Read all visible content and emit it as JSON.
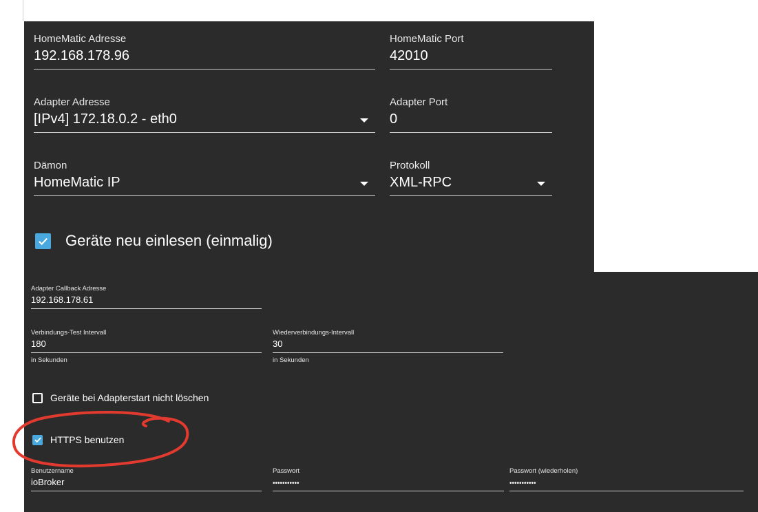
{
  "homematic_address": {
    "label": "HomeMatic Adresse",
    "value": "192.168.178.96"
  },
  "homematic_port": {
    "label": "HomeMatic Port",
    "value": "42010"
  },
  "adapter_address": {
    "label": "Adapter Adresse",
    "value": "[IPv4] 172.18.0.2 - eth0"
  },
  "adapter_port": {
    "label": "Adapter Port",
    "value": "0"
  },
  "daemon": {
    "label": "Dämon",
    "value": "HomeMatic IP"
  },
  "protocol": {
    "label": "Protokoll",
    "value": "XML-RPC"
  },
  "reread_devices": {
    "label": "Geräte neu einlesen (einmalig)",
    "checked": true
  },
  "callback_address": {
    "label": "Adapter Callback Adresse",
    "value": "192.168.178.61"
  },
  "connection_test_interval": {
    "label": "Verbindungs-Test Intervall",
    "value": "180",
    "helper": "in Sekunden"
  },
  "reconnect_interval": {
    "label": "Wiederverbindungs-Intervall",
    "value": "30",
    "helper": "in Sekunden"
  },
  "dont_delete_devices": {
    "label": "Geräte bei Adapterstart nicht löschen",
    "checked": false
  },
  "use_https": {
    "label": "HTTPS benutzen",
    "checked": true
  },
  "username": {
    "label": "Benutzername",
    "value": "ioBroker"
  },
  "password": {
    "label": "Passwort",
    "value": "•••••••••••"
  },
  "password_repeat": {
    "label": "Passwort (wiederholen)",
    "value": "•••••••••••"
  },
  "colors": {
    "panel": "#2b2b2b",
    "checkbox_accent": "#4aa8e0",
    "annotation": "#e23a2e"
  }
}
